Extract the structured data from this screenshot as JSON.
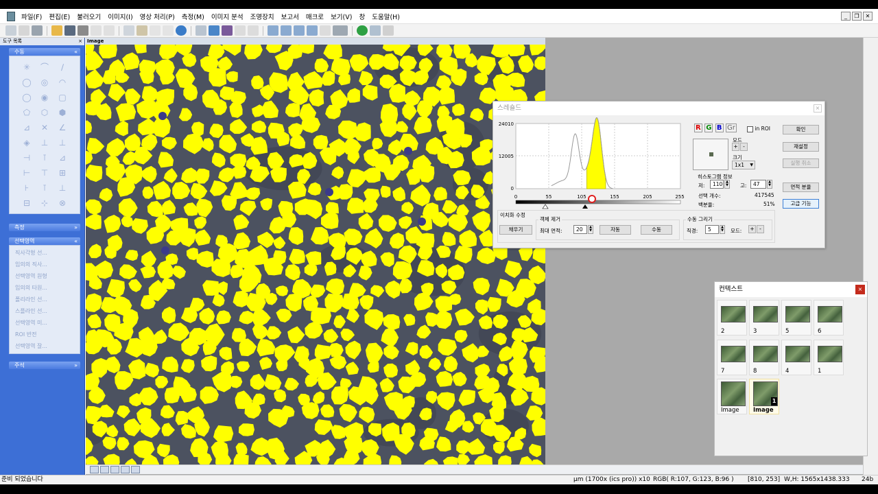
{
  "menubar": {
    "items": [
      "파일(F)",
      "편집(E)",
      "불러오기",
      "이미지(I)",
      "영상 처리(P)",
      "측정(M)",
      "이미지 분석",
      "조명장치",
      "보고서",
      "매크로",
      "보기(V)",
      "창",
      "도움말(H)"
    ]
  },
  "left_panel": {
    "title": "도구 목록",
    "close": "×",
    "sections": {
      "shapes": "수동",
      "measure": "측정",
      "selection": "선택영역",
      "annotation": "주석"
    },
    "shape_icons": [
      "✳",
      "⌒",
      "∕",
      "◯",
      "◎",
      "◠",
      "◯",
      "◉",
      "▢",
      "⬠",
      "⬡",
      "⬢",
      "⊿",
      "✕",
      "∠",
      "◈",
      "⊥",
      "⊥",
      "⊣",
      "⊺",
      "⊿",
      "⊢",
      "⊤",
      "⊞",
      "⊦",
      "⊺",
      "⊥",
      "⊟",
      "⊹",
      "⊗"
    ],
    "selection_items": [
      "직사각형 선...",
      "임의의 직사...",
      "선택영역 원형",
      "임의의 타원...",
      "폴리라인 선...",
      "스플라인 선...",
      "선택영역 미...",
      "ROI 반전",
      "선택영역 잘..."
    ]
  },
  "image_window": {
    "title": "Image"
  },
  "threshold": {
    "title": "스레숄드",
    "close": "×",
    "y_max": "24010",
    "y_mid": "12005",
    "y_min": "0",
    "x_ticks": [
      "0",
      "55",
      "105",
      "155",
      "205",
      "255"
    ],
    "channels": [
      "R",
      "G",
      "B",
      "Gr"
    ],
    "in_roi": "in ROI",
    "mode_label": "모드",
    "size_label": "크기",
    "size_value": "1x1",
    "hist_info_label": "히스토그램 정보",
    "low_label": "저:",
    "low_value": "110",
    "high_label": "고:",
    "high_value": "47",
    "selected_count_label": "선택 개수:",
    "selected_count": "417545",
    "percent_label": "백분율:",
    "percent": "51%",
    "btn_ok": "확인",
    "btn_reset": "재설정",
    "btn_undo": "실행 취소",
    "btn_area": "면적 분율",
    "btn_advanced": "고급 기능",
    "binarize_label": "이치화 수정",
    "btn_fill": "채우기",
    "remove_label": "객체 제거",
    "max_area_label": "최대 면적:",
    "max_area_value": "20",
    "btn_auto": "자동",
    "btn_manual": "수동",
    "draw_label": "수동 그리기",
    "diameter_label": "직경:",
    "diameter_value": "5",
    "mode2_label": "모드:",
    "plus": "+",
    "minus": "-",
    "histogram": {
      "low_threshold": 110,
      "high_threshold": 155,
      "fill_color": "#ffff00"
    }
  },
  "context": {
    "title": "컨텍스트",
    "close": "×",
    "thumbs": [
      "2",
      "3",
      "5",
      "6",
      "7",
      "8",
      "4",
      "1",
      "Image",
      "Image"
    ],
    "badge": "1"
  },
  "status": {
    "ready": "준비 되었습니다",
    "calib": "μm (1700x (ics pro)) x10",
    "rgb": "RGB( R:107, G:123, B:96 )",
    "coord": "[810, 253]",
    "size": "W,H: 1565x1438.333",
    "bits": "24b"
  }
}
